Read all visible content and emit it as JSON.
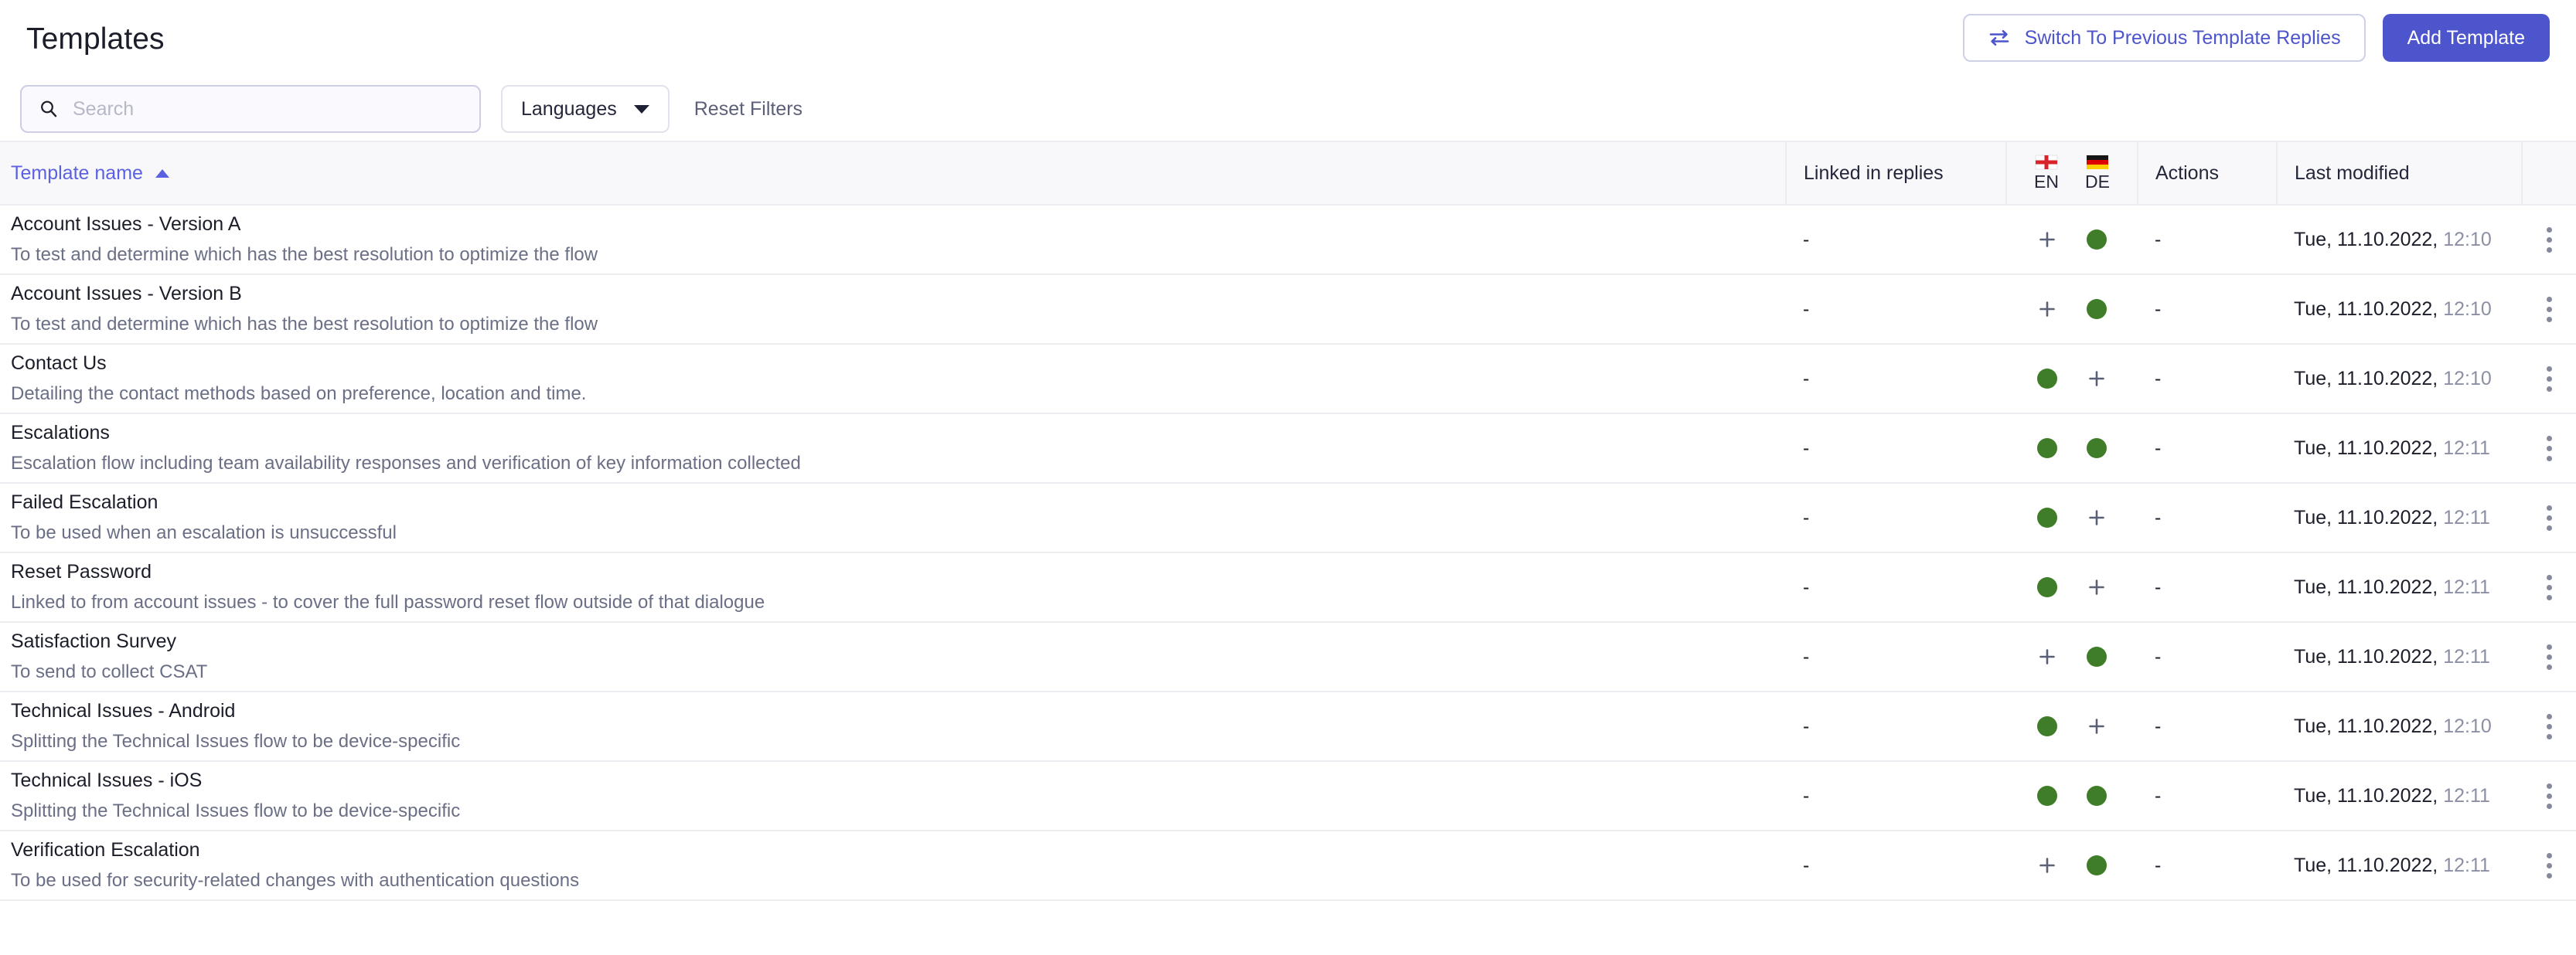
{
  "header": {
    "title": "Templates",
    "switch_button": {
      "label": "Switch To Previous Template Replies",
      "icon": "swap-arrows-icon",
      "text_color": "#4d55cc",
      "border_color": "#cdd0e6"
    },
    "add_button": {
      "label": "Add Template",
      "background": "#4d55cc",
      "text_color": "#ffffff"
    }
  },
  "filters": {
    "search": {
      "icon": "search-icon",
      "value": "",
      "placeholder": "Search"
    },
    "languages_select": {
      "label": "Languages",
      "icon": "chevron-down-icon"
    },
    "reset": {
      "label": "Reset Filters"
    }
  },
  "table": {
    "columns": {
      "name": {
        "label": "Template name",
        "sorted": "asc",
        "sort_icon": "caret-up-icon",
        "color": "#5b61e0"
      },
      "linked": {
        "label": "Linked in replies"
      },
      "languages": [
        {
          "code": "EN",
          "flag": "flag-england-icon"
        },
        {
          "code": "DE",
          "flag": "flag-germany-icon"
        }
      ],
      "actions": {
        "label": "Actions"
      },
      "modified": {
        "label": "Last modified"
      }
    },
    "status_colors": {
      "active": "#3f7d28",
      "add": "#5b6076"
    },
    "rows": [
      {
        "name": "Account Issues - Version A",
        "description": "To test and determine which has the best resolution to optimize the flow",
        "linked": "-",
        "en": "add",
        "de": "active",
        "actions": "-",
        "modified_date": "Tue, 11.10.2022,",
        "modified_time": "12:10",
        "menu_icon": "kebab-menu-icon"
      },
      {
        "name": "Account Issues - Version B",
        "description": "To test and determine which has the best resolution to optimize the flow",
        "linked": "-",
        "en": "add",
        "de": "active",
        "actions": "-",
        "modified_date": "Tue, 11.10.2022,",
        "modified_time": "12:10",
        "menu_icon": "kebab-menu-icon"
      },
      {
        "name": "Contact Us",
        "description": "Detailing the contact methods based on preference, location and time.",
        "linked": "-",
        "en": "active",
        "de": "add",
        "actions": "-",
        "modified_date": "Tue, 11.10.2022,",
        "modified_time": "12:10",
        "menu_icon": "kebab-menu-icon"
      },
      {
        "name": "Escalations",
        "description": "Escalation flow including team availability responses and verification of key information collected",
        "linked": "-",
        "en": "active",
        "de": "active",
        "actions": "-",
        "modified_date": "Tue, 11.10.2022,",
        "modified_time": "12:11",
        "menu_icon": "kebab-menu-icon"
      },
      {
        "name": "Failed Escalation",
        "description": "To be used when an escalation is unsuccessful",
        "linked": "-",
        "en": "active",
        "de": "add",
        "actions": "-",
        "modified_date": "Tue, 11.10.2022,",
        "modified_time": "12:11",
        "menu_icon": "kebab-menu-icon"
      },
      {
        "name": "Reset Password",
        "description": "Linked to from account issues - to cover the full password reset flow outside of that dialogue",
        "linked": "-",
        "en": "active",
        "de": "add",
        "actions": "-",
        "modified_date": "Tue, 11.10.2022,",
        "modified_time": "12:11",
        "menu_icon": "kebab-menu-icon"
      },
      {
        "name": "Satisfaction Survey",
        "description": "To send to collect CSAT",
        "linked": "-",
        "en": "add",
        "de": "active",
        "actions": "-",
        "modified_date": "Tue, 11.10.2022,",
        "modified_time": "12:11",
        "menu_icon": "kebab-menu-icon"
      },
      {
        "name": "Technical Issues - Android",
        "description": "Splitting the Technical Issues flow to be device-specific",
        "linked": "-",
        "en": "active",
        "de": "add",
        "actions": "-",
        "modified_date": "Tue, 11.10.2022,",
        "modified_time": "12:10",
        "menu_icon": "kebab-menu-icon"
      },
      {
        "name": "Technical Issues - iOS",
        "description": "Splitting the Technical Issues flow to be device-specific",
        "linked": "-",
        "en": "active",
        "de": "active",
        "actions": "-",
        "modified_date": "Tue, 11.10.2022,",
        "modified_time": "12:11",
        "menu_icon": "kebab-menu-icon"
      },
      {
        "name": "Verification Escalation",
        "description": "To be used for security-related changes with authentication questions",
        "linked": "-",
        "en": "add",
        "de": "active",
        "actions": "-",
        "modified_date": "Tue, 11.10.2022,",
        "modified_time": "12:11",
        "menu_icon": "kebab-menu-icon"
      }
    ]
  }
}
